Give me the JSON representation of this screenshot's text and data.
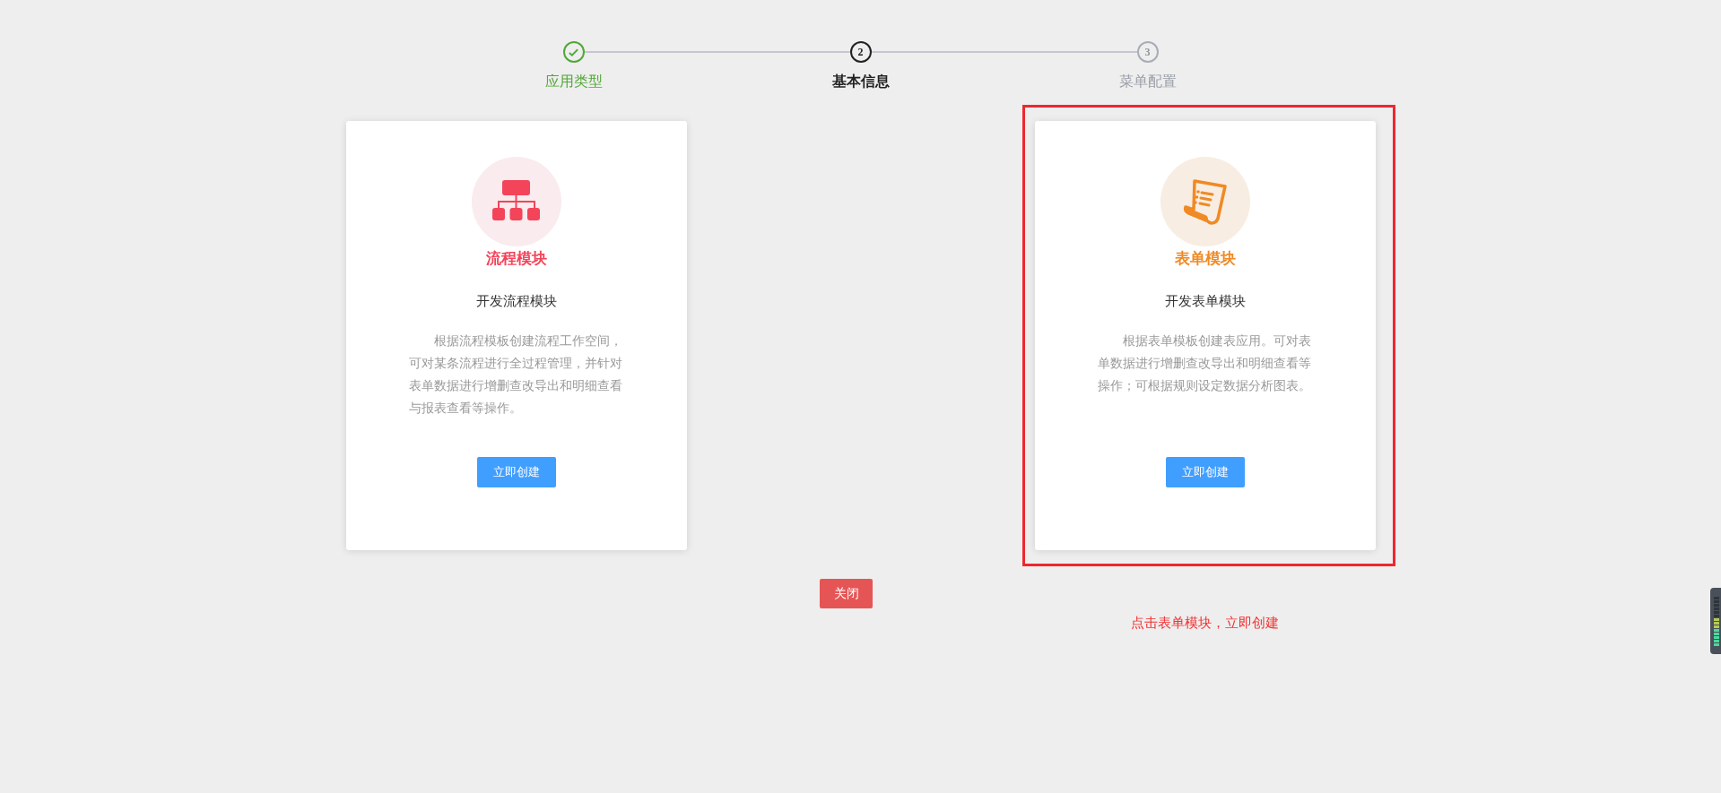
{
  "steps": [
    {
      "label": "应用类型",
      "kind": "done"
    },
    {
      "label": "基本信息",
      "number": "2",
      "kind": "active"
    },
    {
      "label": "菜单配置",
      "number": "3",
      "kind": "pending"
    }
  ],
  "cards": [
    {
      "kind": "flowchart",
      "title": "流程模块",
      "subtitle": "开发流程模块",
      "description": "根据流程模板创建流程工作空间，可对某条流程进行全过程管理，并针对表单数据进行增删查改导出和明细查看与报表查看等操作。",
      "button": "立即创建",
      "color": "#f4445a",
      "highlighted": false
    },
    {
      "kind": "document",
      "title": "表单模块",
      "subtitle": "开发表单模块",
      "description": "根据表单模板创建表应用。可对表单数据进行增删查改导出和明细查看等操作；可根据规则设定数据分析图表。",
      "button": "立即创建",
      "color": "#f08a24",
      "highlighted": true,
      "annotation": "点击表单模块，立即创建"
    }
  ],
  "close_button": "关闭"
}
